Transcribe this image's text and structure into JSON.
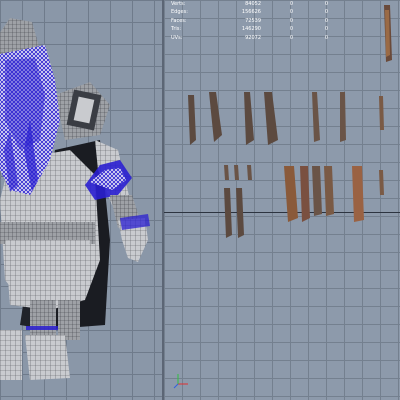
{
  "hud": {
    "rows": [
      {
        "label": "Verts:",
        "value": "84052",
        "selected": "0",
        "percent": "0"
      },
      {
        "label": "Edges:",
        "value": "156626",
        "selected": "0",
        "percent": "0"
      },
      {
        "label": "Faces:",
        "value": "72539",
        "selected": "0",
        "percent": "0"
      },
      {
        "label": "Tris:",
        "value": "146290",
        "selected": "0",
        "percent": "0"
      },
      {
        "label": "UVs:",
        "value": "92072",
        "selected": "0",
        "percent": "0"
      }
    ]
  },
  "viewports": {
    "left": {
      "content": "3d-wireframe-character"
    },
    "right": {
      "content": "uv-texture-editor"
    }
  },
  "colors": {
    "grid_bg_left": "#8a97a8",
    "grid_bg_right": "#8d9aab",
    "wire_blue": "#2a1fd0",
    "uv_brown": "#8a5a3a"
  }
}
